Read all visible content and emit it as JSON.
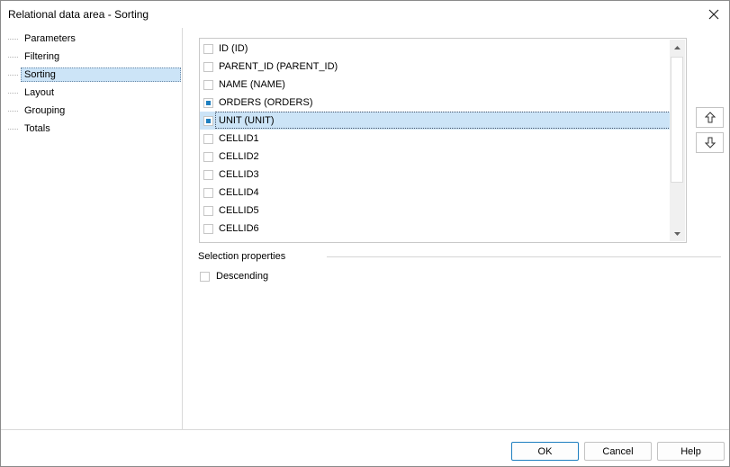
{
  "window": {
    "title": "Relational data area - Sorting"
  },
  "nav": {
    "items": [
      {
        "label": "Parameters",
        "selected": false
      },
      {
        "label": "Filtering",
        "selected": false
      },
      {
        "label": "Sorting",
        "selected": true
      },
      {
        "label": "Layout",
        "selected": false
      },
      {
        "label": "Grouping",
        "selected": false
      },
      {
        "label": "Totals",
        "selected": false
      }
    ]
  },
  "fields": {
    "items": [
      {
        "label": "ID (ID)",
        "checked": false,
        "selected": false
      },
      {
        "label": "PARENT_ID (PARENT_ID)",
        "checked": false,
        "selected": false
      },
      {
        "label": "NAME (NAME)",
        "checked": false,
        "selected": false
      },
      {
        "label": "ORDERS (ORDERS)",
        "checked": true,
        "selected": false
      },
      {
        "label": "UNIT (UNIT)",
        "checked": true,
        "selected": true
      },
      {
        "label": "CELLID1",
        "checked": false,
        "selected": false
      },
      {
        "label": "CELLID2",
        "checked": false,
        "selected": false
      },
      {
        "label": "CELLID3",
        "checked": false,
        "selected": false
      },
      {
        "label": "CELLID4",
        "checked": false,
        "selected": false
      },
      {
        "label": "CELLID5",
        "checked": false,
        "selected": false
      },
      {
        "label": "CELLID6",
        "checked": false,
        "selected": false
      }
    ]
  },
  "selection_properties": {
    "heading": "Selection properties",
    "descending_label": "Descending",
    "descending_checked": false
  },
  "footer": {
    "ok_label": "OK",
    "cancel_label": "Cancel",
    "help_label": "Help"
  },
  "colors": {
    "selection": "#cce4f7",
    "check_accent": "#1e7fc0"
  }
}
